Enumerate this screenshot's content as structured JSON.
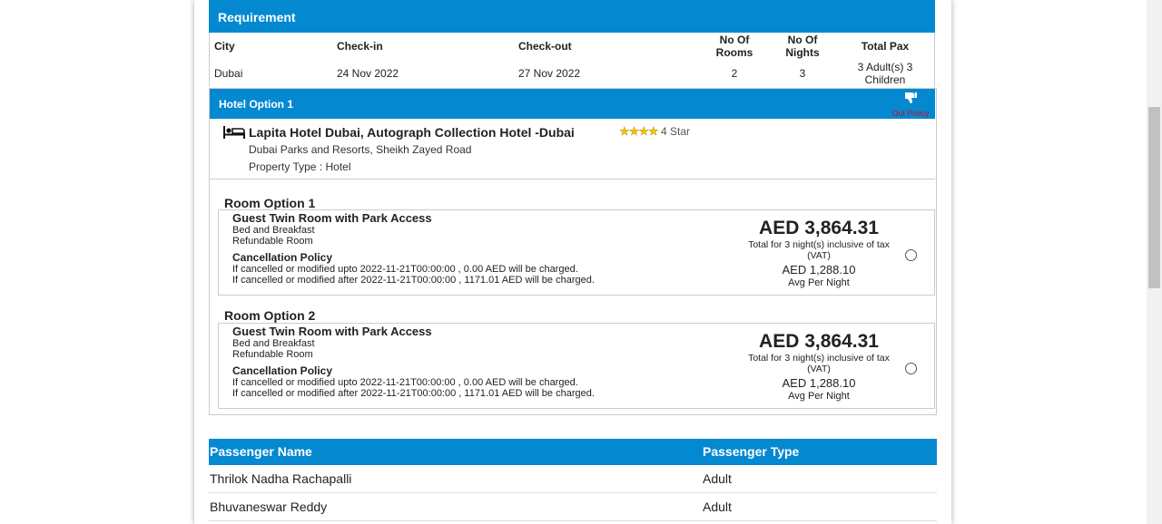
{
  "requirement": {
    "title": "Requirement",
    "headers": {
      "city": "City",
      "checkin": "Check-in",
      "checkout": "Check-out",
      "rooms_1": "No Of",
      "rooms_2": "Rooms",
      "nights_1": "No Of",
      "nights_2": "Nights",
      "pax": "Total Pax"
    },
    "row": {
      "city": "Dubai",
      "checkin": "24 Nov 2022",
      "checkout": "27 Nov 2022",
      "rooms": "2",
      "nights": "3",
      "pax_1": "3 Adult(s) 3",
      "pax_2": "Children"
    }
  },
  "hotel": {
    "option_label": "Hotel Option 1",
    "policy_label": "Out Policy",
    "name": "Lapita Hotel Dubai, Autograph Collection Hotel -Dubai",
    "star_count": 4,
    "star_label": "4 Star",
    "address": "Dubai Parks and Resorts, Sheikh Zayed Road",
    "property_type": "Property Type : Hotel"
  },
  "rooms": [
    {
      "option_title": "Room Option 1",
      "name": "Guest Twin Room with Park Access",
      "meal": "Bed and Breakfast",
      "refund": "Refundable Room",
      "policy_title": "Cancellation Policy",
      "policy_1": "If cancelled or modified upto 2022-11-21T00:00:00 , 0.00 AED will be charged.",
      "policy_2": "If cancelled or modified after 2022-11-21T00:00:00 , 1171.01 AED will be charged.",
      "price": "AED 3,864.31",
      "price_note_1": "Total for 3 night(s) inclusive of tax",
      "price_note_2": "(VAT)",
      "per_night": "AED 1,288.10",
      "per_night_label": "Avg Per Night"
    },
    {
      "option_title": "Room Option 2",
      "name": "Guest Twin Room with Park Access",
      "meal": "Bed and Breakfast",
      "refund": "Refundable Room",
      "policy_title": "Cancellation Policy",
      "policy_1": "If cancelled or modified upto 2022-11-21T00:00:00 , 0.00 AED will be charged.",
      "policy_2": "If cancelled or modified after 2022-11-21T00:00:00 , 1171.01 AED will be charged.",
      "price": "AED 3,864.31",
      "price_note_1": "Total for 3 night(s) inclusive of tax",
      "price_note_2": "(VAT)",
      "per_night": "AED 1,288.10",
      "per_night_label": "Avg Per Night"
    }
  ],
  "passengers": {
    "headers": {
      "name": "Passenger Name",
      "type": "Passenger Type"
    },
    "rows": [
      {
        "name": "Thrilok Nadha Rachapalli",
        "type": "Adult"
      },
      {
        "name": "Bhuvaneswar Reddy",
        "type": "Adult"
      }
    ]
  },
  "colors": {
    "header_blue": "#0489d1",
    "policy_red": "#c0122b",
    "star_gold": "#f5c400"
  }
}
